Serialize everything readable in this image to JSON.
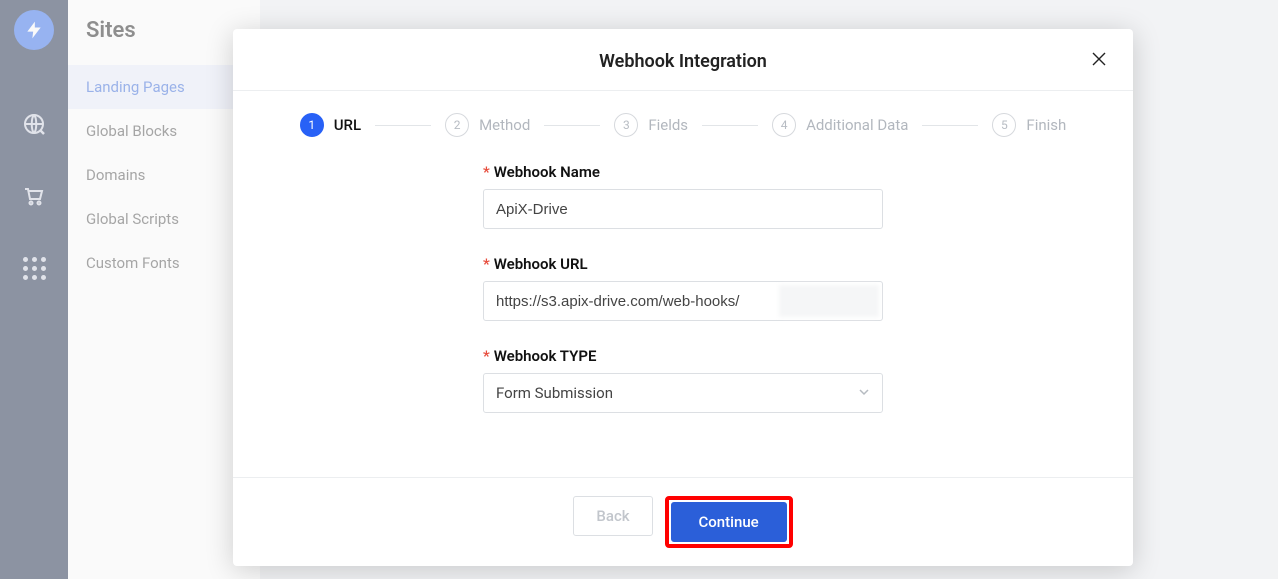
{
  "sidebar": {
    "title": "Sites",
    "items": [
      {
        "label": "Landing Pages",
        "active": true
      },
      {
        "label": "Global Blocks",
        "active": false
      },
      {
        "label": "Domains",
        "active": false
      },
      {
        "label": "Global Scripts",
        "active": false
      },
      {
        "label": "Custom Fonts",
        "active": false
      }
    ]
  },
  "modal": {
    "title": "Webhook Integration",
    "steps": [
      {
        "num": "1",
        "label": "URL",
        "active": true
      },
      {
        "num": "2",
        "label": "Method",
        "active": false
      },
      {
        "num": "3",
        "label": "Fields",
        "active": false
      },
      {
        "num": "4",
        "label": "Additional Data",
        "active": false
      },
      {
        "num": "5",
        "label": "Finish",
        "active": false
      }
    ],
    "fields": {
      "name": {
        "label": "Webhook Name",
        "value": "ApiX-Drive"
      },
      "url": {
        "label": "Webhook URL",
        "value": "https://s3.apix-drive.com/web-hooks/"
      },
      "type": {
        "label": "Webhook TYPE",
        "value": "Form Submission"
      }
    },
    "buttons": {
      "back": "Back",
      "continue": "Continue"
    }
  }
}
